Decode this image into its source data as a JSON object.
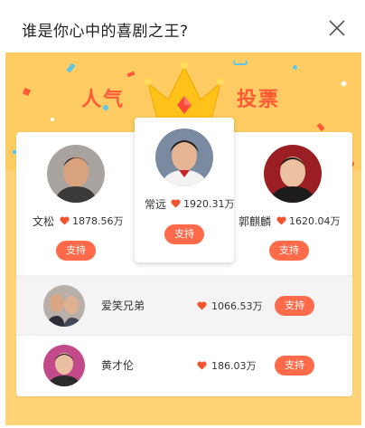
{
  "header": {
    "title": "谁是你心中的喜剧之王?"
  },
  "banner": {
    "left_word": "人气",
    "right_word": "投票"
  },
  "colors": {
    "accent": "#ff6b4a",
    "banner_bg": "#ffd479",
    "heart": "#f0552f",
    "title_word": "#ff5a36",
    "crown": "#ffc21a"
  },
  "top3": {
    "left": {
      "name": "文松",
      "votes": "1878.56万",
      "button": "支持",
      "heart_icon": "heart-icon"
    },
    "center": {
      "name": "常远",
      "votes": "1920.31万",
      "button": "支持",
      "heart_icon": "heart-icon"
    },
    "right": {
      "name": "郭麒麟",
      "votes": "1620.04万",
      "button": "支持",
      "heart_icon": "heart-icon"
    }
  },
  "list": [
    {
      "name": "爱笑兄弟",
      "votes": "1066.53万",
      "button": "支持"
    },
    {
      "name": "黄才伦",
      "votes": "186.03万",
      "button": "支持"
    }
  ]
}
